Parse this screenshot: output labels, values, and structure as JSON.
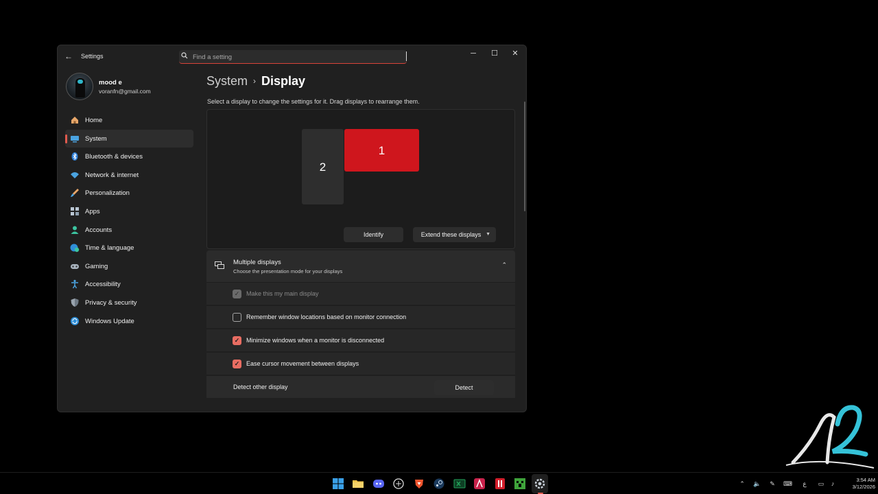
{
  "window": {
    "app_title": "Settings",
    "search_placeholder": "Find a setting",
    "min_symbol": "─",
    "max_symbol": "☐",
    "close_symbol": "✕",
    "back_symbol": "←"
  },
  "profile": {
    "name": "mood e",
    "email": "voranfn@gmail.com"
  },
  "nav": {
    "items": [
      {
        "label": "Home",
        "icon": "home-icon",
        "active": false
      },
      {
        "label": "System",
        "icon": "system-icon",
        "active": true
      },
      {
        "label": "Bluetooth & devices",
        "icon": "bluetooth-icon",
        "active": false
      },
      {
        "label": "Network & internet",
        "icon": "wifi-icon",
        "active": false
      },
      {
        "label": "Personalization",
        "icon": "brush-icon",
        "active": false
      },
      {
        "label": "Apps",
        "icon": "apps-icon",
        "active": false
      },
      {
        "label": "Accounts",
        "icon": "account-icon",
        "active": false
      },
      {
        "label": "Time & language",
        "icon": "globe-clock-icon",
        "active": false
      },
      {
        "label": "Gaming",
        "icon": "controller-icon",
        "active": false
      },
      {
        "label": "Accessibility",
        "icon": "accessibility-icon",
        "active": false
      },
      {
        "label": "Privacy & security",
        "icon": "shield-icon",
        "active": false
      },
      {
        "label": "Windows Update",
        "icon": "update-icon",
        "active": false
      }
    ]
  },
  "main": {
    "breadcrumb_parent": "System",
    "breadcrumb_sep": "›",
    "breadcrumb_current": "Display",
    "hint": "Select a display to change the settings for it. Drag displays to rearrange them.",
    "monitor_1": "1",
    "monitor_2": "2",
    "identify_label": "Identify",
    "extend_label": "Extend these displays",
    "multiple": {
      "title": "Multiple displays",
      "desc": "Choose the presentation mode for your displays"
    },
    "options": [
      {
        "label": "Make this my main display",
        "checked": true,
        "disabled": true
      },
      {
        "label": "Remember window locations based on monitor connection",
        "checked": false,
        "disabled": false
      },
      {
        "label": "Minimize windows when a monitor is disconnected",
        "checked": true,
        "disabled": false
      },
      {
        "label": "Ease cursor movement between displays",
        "checked": true,
        "disabled": false
      }
    ],
    "detect_row_label": "Detect other display",
    "detect_label": "Detect"
  },
  "taskbar": {
    "time": "3:54 AM",
    "date": "3/12/2026",
    "lang": "ع",
    "apps": [
      "windows-start-icon",
      "file-explorer-icon",
      "discord-icon",
      "chatgpt-icon",
      "brave-icon",
      "steam-icon",
      "excel-icon",
      "app-a-icon",
      "app-red-icon",
      "minecraft-icon",
      "settings-icon"
    ]
  },
  "colors": {
    "accent": "#e05a4e",
    "primary_monitor": "#cf161d",
    "checkbox_checked": "#e86d62"
  }
}
